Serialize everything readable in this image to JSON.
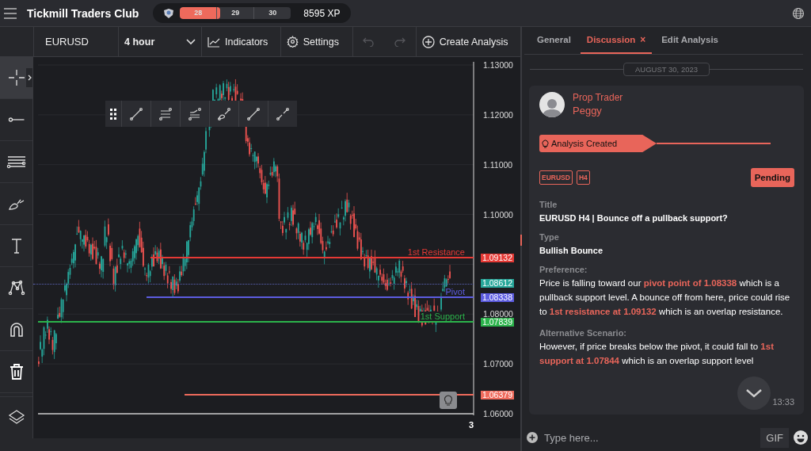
{
  "header": {
    "title": "Tickmill Traders Club",
    "progress": {
      "segments": [
        "28",
        "29",
        "30"
      ],
      "level": 0.36
    },
    "xp": "8595 XP"
  },
  "chart_toolbar": {
    "symbol": "EURUSD",
    "timeframe": "4 hour",
    "indicators": "Indicators",
    "settings": "Settings",
    "undo_disabled": true,
    "redo_disabled": true,
    "create": "Create Analysis"
  },
  "tools": [
    {
      "selected": true
    },
    {
      "selected": false
    },
    {
      "selected": false
    },
    {
      "selected": false
    },
    {
      "selected": false
    },
    {
      "selected": false
    },
    {
      "selected": false
    },
    {
      "selected": false
    },
    {
      "selected": false
    }
  ],
  "price_axis": {
    "ticks": [
      "1.13000",
      "1.12000",
      "1.11000",
      "1.10000",
      "1.08000",
      "1.07000",
      "1.06000"
    ],
    "x_label": "3"
  },
  "levels": [
    {
      "kind": "level",
      "label": "1st Resistance",
      "price": "1.09132",
      "color": "#e53935"
    },
    {
      "kind": "last_price",
      "price": "1.08612",
      "color": "#26a69a"
    },
    {
      "kind": "level",
      "label": "Pivot",
      "price": "1.08338",
      "color": "#5c5ce0"
    },
    {
      "kind": "level",
      "label": "1st Support",
      "price": "1.07839",
      "color": "#2bb34b"
    },
    {
      "kind": "level",
      "price": "1.06379",
      "color": "#ee6a5c"
    }
  ],
  "panel": {
    "tabs": [
      {
        "label": "General",
        "selected": false
      },
      {
        "label": "Discussion",
        "selected": true,
        "close": "×"
      },
      {
        "label": "Edit Analysis",
        "selected": false
      }
    ],
    "date": "AUGUST 30, 2023",
    "post": {
      "role": "Prop Trader",
      "author": "Peggy",
      "banner": "Analysis Created",
      "tags": [
        "EURUSD",
        "H4"
      ],
      "status": "Pending",
      "fields": [
        {
          "kind": "short",
          "label": "Title",
          "value": "EURUSD H4 | Bounce off a pullback support?"
        },
        {
          "kind": "short",
          "label": "Type",
          "value": "Bullish Bounce"
        },
        {
          "kind": "long",
          "label": "Preference:",
          "value": "Price is falling toward our **pivot point of 1.08338** which is  a pullback support level. A bounce off from here, price could rise to **1st resistance at 1.09132** which is an overlap resistance."
        },
        {
          "kind": "long",
          "label": "Alternative Scenario:",
          "value": "However, if price breaks below the pivot, it could fall to **1st support at 1.07844** which is an overlap support level"
        }
      ],
      "time": "13:33"
    },
    "input": {
      "placeholder": "Type here...",
      "gif": "GIF"
    }
  }
}
